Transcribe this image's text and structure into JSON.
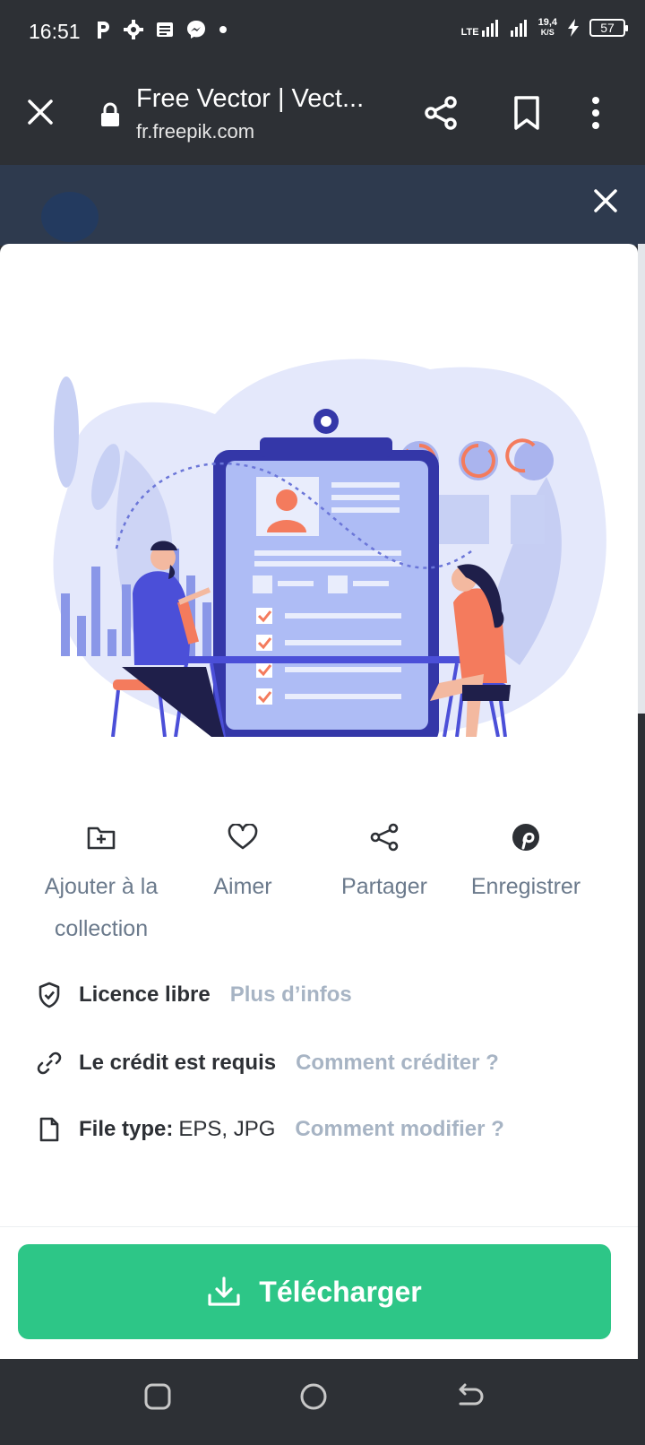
{
  "status": {
    "time": "16:51",
    "lte": "LTE",
    "net_speed_top": "19,4",
    "net_speed_bottom": "K/S",
    "battery": "57"
  },
  "browser": {
    "title": "Free Vector | Vect...",
    "url": "fr.freepik.com"
  },
  "actions": [
    {
      "label": "Ajouter à la collection",
      "icon": "folder-plus-icon"
    },
    {
      "label": "Aimer",
      "icon": "heart-icon"
    },
    {
      "label": "Partager",
      "icon": "share-icon"
    },
    {
      "label": "Enregistrer",
      "icon": "pinterest-icon"
    }
  ],
  "info": {
    "license": {
      "label": "Licence libre",
      "link": "Plus d’infos"
    },
    "credit": {
      "label": "Le crédit est requis",
      "link": "Comment créditer ?"
    },
    "filetype": {
      "label": "File type:",
      "value": "EPS, JPG",
      "link": "Comment modifier ?"
    }
  },
  "download": {
    "label": "Télécharger"
  },
  "colors": {
    "accent_green": "#2dc687",
    "illustration_primary": "#4b4fd8",
    "illustration_accent": "#f47b5d"
  }
}
